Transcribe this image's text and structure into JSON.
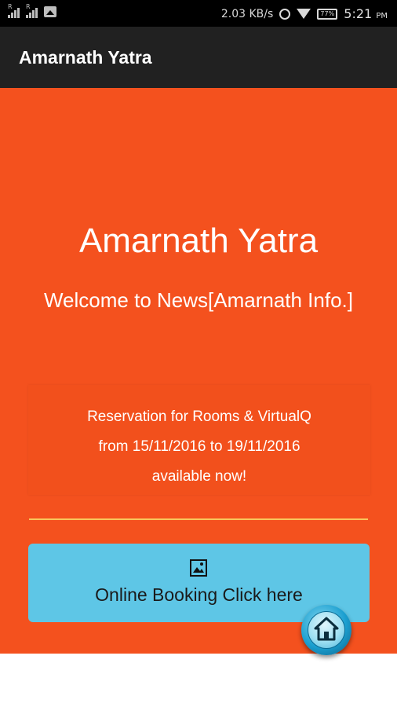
{
  "status_bar": {
    "sim1_label": "R",
    "sim2_label": "R",
    "speed": "2.03 KB/s",
    "battery": "77%",
    "time": "5:21",
    "ampm": "PM",
    "icons": [
      "signal-icon",
      "signal-icon",
      "image-icon",
      "alarm-icon",
      "wifi-icon",
      "battery-icon"
    ]
  },
  "app_bar": {
    "title": "Amarnath Yatra"
  },
  "hero": {
    "title": "Amarnath Yatra",
    "subtitle": "Welcome to News[Amarnath Info.]"
  },
  "notice": {
    "line1": "Reservation for Rooms & VirtualQ",
    "line2": "from 15/11/2016 to 19/11/2016",
    "line3": "available now!"
  },
  "booking": {
    "label": "Online Booking Click here",
    "icon": "picture-icon"
  },
  "fab": {
    "icon": "home-icon"
  },
  "colors": {
    "main_background": "#f4511e",
    "app_bar": "#212121",
    "button": "#5ec6e6",
    "divider": "#f9c65c"
  }
}
